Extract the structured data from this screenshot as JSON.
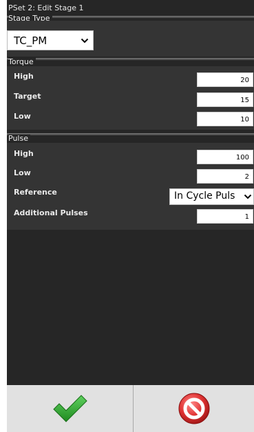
{
  "header": {
    "title": "PSet 2: Edit Stage 1"
  },
  "stage_type": {
    "label": "Stage Type",
    "value": "TC_PM"
  },
  "torque": {
    "label": "Torque",
    "rows": [
      {
        "label": "High",
        "value": "20"
      },
      {
        "label": "Target",
        "value": "15"
      },
      {
        "label": "Low",
        "value": "10"
      }
    ]
  },
  "pulse": {
    "label": "Pulse",
    "high": {
      "label": "High",
      "value": "100"
    },
    "low": {
      "label": "Low",
      "value": "2"
    },
    "reference": {
      "label": "Reference",
      "value": "In Cycle Puls"
    },
    "additional": {
      "label": "Additional Pulses",
      "value": "1"
    }
  },
  "buttons": {
    "confirm_icon": "checkmark-icon",
    "cancel_icon": "cancel-icon"
  },
  "colors": {
    "confirm_green": "#2e9e2e",
    "cancel_red": "#d83a3a"
  }
}
